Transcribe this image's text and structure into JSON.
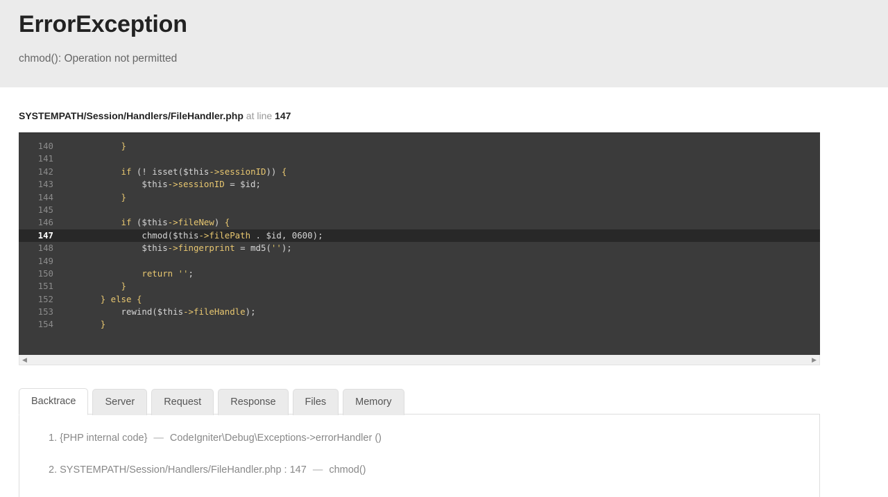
{
  "header": {
    "title": "ErrorException",
    "message": "chmod(): Operation not permitted"
  },
  "source": {
    "file": "SYSTEMPATH/Session/Handlers/FileHandler.php",
    "at_line_label": "at line",
    "line": "147"
  },
  "code": {
    "highlight_line": 147,
    "lines": [
      {
        "num": "140",
        "tokens": [
          {
            "t": "            ",
            "c": "punct"
          },
          {
            "t": "}",
            "c": "brace"
          }
        ]
      },
      {
        "num": "141",
        "tokens": [
          {
            "t": "",
            "c": "punct"
          }
        ]
      },
      {
        "num": "142",
        "tokens": [
          {
            "t": "            ",
            "c": "punct"
          },
          {
            "t": "if",
            "c": "kw"
          },
          {
            "t": " (! ",
            "c": "punct"
          },
          {
            "t": "isset",
            "c": "var"
          },
          {
            "t": "(",
            "c": "punct"
          },
          {
            "t": "$this",
            "c": "var"
          },
          {
            "t": "->sessionID",
            "c": "prop"
          },
          {
            "t": ")) ",
            "c": "punct"
          },
          {
            "t": "{",
            "c": "brace"
          }
        ]
      },
      {
        "num": "143",
        "tokens": [
          {
            "t": "                ",
            "c": "punct"
          },
          {
            "t": "$this",
            "c": "var"
          },
          {
            "t": "->sessionID",
            "c": "prop"
          },
          {
            "t": " = ",
            "c": "punct"
          },
          {
            "t": "$id",
            "c": "var"
          },
          {
            "t": ";",
            "c": "punct"
          }
        ]
      },
      {
        "num": "144",
        "tokens": [
          {
            "t": "            ",
            "c": "punct"
          },
          {
            "t": "}",
            "c": "brace"
          }
        ]
      },
      {
        "num": "145",
        "tokens": [
          {
            "t": "",
            "c": "punct"
          }
        ]
      },
      {
        "num": "146",
        "tokens": [
          {
            "t": "            ",
            "c": "punct"
          },
          {
            "t": "if",
            "c": "kw"
          },
          {
            "t": " (",
            "c": "punct"
          },
          {
            "t": "$this",
            "c": "var"
          },
          {
            "t": "->fileNew",
            "c": "prop"
          },
          {
            "t": ") ",
            "c": "punct"
          },
          {
            "t": "{",
            "c": "brace"
          }
        ]
      },
      {
        "num": "147",
        "tokens": [
          {
            "t": "                ",
            "c": "punct"
          },
          {
            "t": "chmod",
            "c": "var"
          },
          {
            "t": "(",
            "c": "punct"
          },
          {
            "t": "$this",
            "c": "var"
          },
          {
            "t": "->filePath",
            "c": "prop"
          },
          {
            "t": " . ",
            "c": "punct"
          },
          {
            "t": "$id",
            "c": "var"
          },
          {
            "t": ", ",
            "c": "punct"
          },
          {
            "t": "0600",
            "c": "num"
          },
          {
            "t": ");",
            "c": "punct"
          }
        ]
      },
      {
        "num": "148",
        "tokens": [
          {
            "t": "                ",
            "c": "punct"
          },
          {
            "t": "$this",
            "c": "var"
          },
          {
            "t": "->fingerprint",
            "c": "prop"
          },
          {
            "t": " = ",
            "c": "punct"
          },
          {
            "t": "md5",
            "c": "var"
          },
          {
            "t": "(",
            "c": "punct"
          },
          {
            "t": "''",
            "c": "str"
          },
          {
            "t": ");",
            "c": "punct"
          }
        ]
      },
      {
        "num": "149",
        "tokens": [
          {
            "t": "",
            "c": "punct"
          }
        ]
      },
      {
        "num": "150",
        "tokens": [
          {
            "t": "                ",
            "c": "punct"
          },
          {
            "t": "return",
            "c": "kw"
          },
          {
            "t": " ",
            "c": "punct"
          },
          {
            "t": "''",
            "c": "str"
          },
          {
            "t": ";",
            "c": "punct"
          }
        ]
      },
      {
        "num": "151",
        "tokens": [
          {
            "t": "            ",
            "c": "punct"
          },
          {
            "t": "}",
            "c": "brace"
          }
        ]
      },
      {
        "num": "152",
        "tokens": [
          {
            "t": "        ",
            "c": "punct"
          },
          {
            "t": "}",
            "c": "brace"
          },
          {
            "t": " ",
            "c": "punct"
          },
          {
            "t": "else",
            "c": "kw"
          },
          {
            "t": " ",
            "c": "punct"
          },
          {
            "t": "{",
            "c": "brace"
          }
        ]
      },
      {
        "num": "153",
        "tokens": [
          {
            "t": "            ",
            "c": "punct"
          },
          {
            "t": "rewind",
            "c": "var"
          },
          {
            "t": "(",
            "c": "punct"
          },
          {
            "t": "$this",
            "c": "var"
          },
          {
            "t": "->fileHandle",
            "c": "prop"
          },
          {
            "t": ");",
            "c": "punct"
          }
        ]
      },
      {
        "num": "154",
        "tokens": [
          {
            "t": "        ",
            "c": "punct"
          },
          {
            "t": "}",
            "c": "brace"
          }
        ]
      }
    ]
  },
  "scrollbar": {
    "left_arrow": "◀",
    "right_arrow": "▶"
  },
  "tabs": [
    {
      "label": "Backtrace",
      "active": true
    },
    {
      "label": "Server",
      "active": false
    },
    {
      "label": "Request",
      "active": false
    },
    {
      "label": "Response",
      "active": false
    },
    {
      "label": "Files",
      "active": false
    },
    {
      "label": "Memory",
      "active": false
    }
  ],
  "backtrace": {
    "dash": "—",
    "items": [
      {
        "num": "1.",
        "location": "{PHP internal code}",
        "call": "CodeIgniter\\Debug\\Exceptions->errorHandler ()"
      },
      {
        "num": "2.",
        "location": "SYSTEMPATH/Session/Handlers/FileHandler.php : 147",
        "call": "chmod()"
      }
    ]
  },
  "colors": {
    "header_bg": "#ebebeb",
    "code_bg": "#3b3b3b",
    "code_highlight_bg": "#282828",
    "keyword": "#e8c770",
    "string": "#d9c06a",
    "border": "#dddddd"
  }
}
